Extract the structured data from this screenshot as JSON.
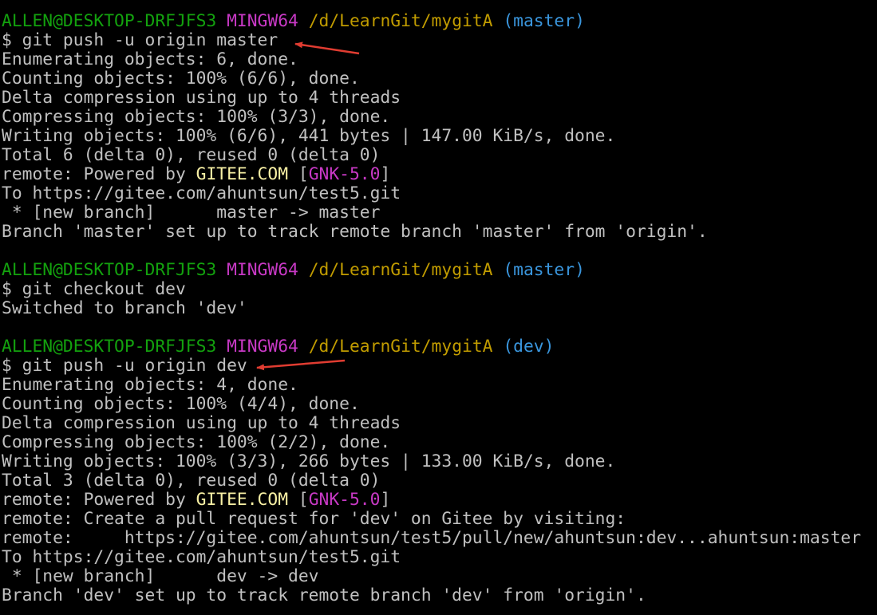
{
  "colors": {
    "background": "#000000",
    "text": "#c0c0c0",
    "prompt_user": "#13a10e",
    "prompt_env": "#c839c5",
    "prompt_path": "#c19c00",
    "prompt_branch": "#3a96dd",
    "gitee": "#f9f1a5",
    "gnk": "#c839c5",
    "arrow": "#e03c31"
  },
  "session1": {
    "prompt": {
      "user": "ALLEN@DESKTOP-DRFJFS3",
      "env": "MINGW64",
      "path": "/d/LearnGit/mygitA",
      "branch": "(master)"
    },
    "command": "$ git push -u origin master",
    "out": [
      "Enumerating objects: 6, done.",
      "Counting objects: 100% (6/6), done.",
      "Delta compression using up to 4 threads",
      "Compressing objects: 100% (3/3), done.",
      "Writing objects: 100% (6/6), 441 bytes | 147.00 KiB/s, done.",
      "Total 6 (delta 0), reused 0 (delta 0)"
    ],
    "remote_powered": {
      "prefix": "remote: Powered by ",
      "gitee": "GITEE.COM",
      "bracket_open": " [",
      "gnk": "GNK-5.0",
      "bracket_close": "]"
    },
    "out2": [
      "To https://gitee.com/ahuntsun/test5.git",
      " * [new branch]      master -> master",
      "Branch 'master' set up to track remote branch 'master' from 'origin'."
    ]
  },
  "session2": {
    "prompt": {
      "user": "ALLEN@DESKTOP-DRFJFS3",
      "env": "MINGW64",
      "path": "/d/LearnGit/mygitA",
      "branch": "(master)"
    },
    "command": "$ git checkout dev",
    "out": [
      "Switched to branch 'dev'"
    ]
  },
  "session3": {
    "prompt": {
      "user": "ALLEN@DESKTOP-DRFJFS3",
      "env": "MINGW64",
      "path": "/d/LearnGit/mygitA",
      "branch": "(dev)"
    },
    "command": "$ git push -u origin dev",
    "out": [
      "Enumerating objects: 4, done.",
      "Counting objects: 100% (4/4), done.",
      "Delta compression using up to 4 threads",
      "Compressing objects: 100% (2/2), done.",
      "Writing objects: 100% (3/3), 266 bytes | 133.00 KiB/s, done.",
      "Total 3 (delta 0), reused 0 (delta 0)"
    ],
    "remote_powered": {
      "prefix": "remote: Powered by ",
      "gitee": "GITEE.COM",
      "bracket_open": " [",
      "gnk": "GNK-5.0",
      "bracket_close": "]"
    },
    "out2": [
      "remote: Create a pull request for 'dev' on Gitee by visiting:",
      "remote:     https://gitee.com/ahuntsun/test5/pull/new/ahuntsun:dev...ahuntsun:master",
      "To https://gitee.com/ahuntsun/test5.git",
      " * [new branch]      dev -> dev",
      "Branch 'dev' set up to track remote branch 'dev' from 'origin'."
    ]
  }
}
